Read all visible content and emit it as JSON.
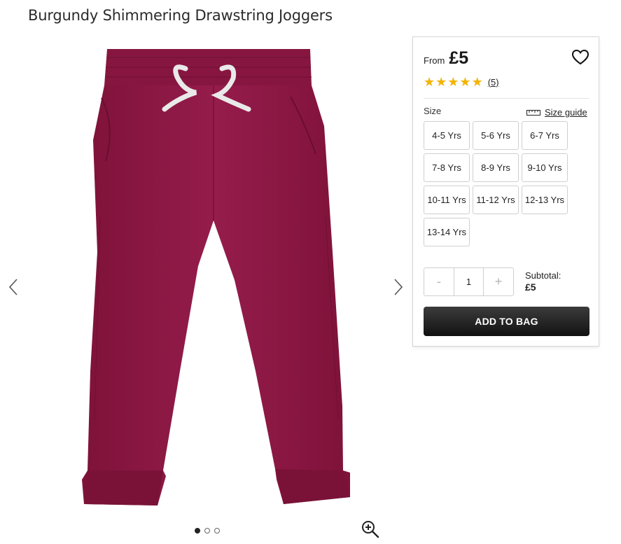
{
  "product": {
    "title": "Burgundy Shimmering Drawstring Joggers"
  },
  "gallery": {
    "image_alt": "Burgundy drawstring joggers",
    "slides": [
      {
        "active": true
      },
      {
        "active": false
      },
      {
        "active": false
      }
    ],
    "icons": {
      "prev": "chevron-left-icon",
      "next": "chevron-right-icon",
      "zoom": "zoom-in-icon"
    }
  },
  "purchase": {
    "from_label": "From",
    "price": "£5",
    "rating": {
      "stars": 5,
      "count_label": "(5)"
    },
    "size_label": "Size",
    "size_guide_label": "Size guide",
    "sizes": [
      "4-5 Yrs",
      "5-6 Yrs",
      "6-7 Yrs",
      "7-8 Yrs",
      "8-9 Yrs",
      "9-10 Yrs",
      "10-11 Yrs",
      "11-12 Yrs",
      "12-13 Yrs",
      "13-14 Yrs"
    ],
    "quantity": {
      "minus": "-",
      "value": "1",
      "plus": "+"
    },
    "subtotal_label": "Subtotal:",
    "subtotal_value": "£5",
    "add_to_bag_label": "ADD TO BAG"
  },
  "colors": {
    "garment": "#8e1a45",
    "star": "#f5b301",
    "button": "#1f1f1f"
  }
}
